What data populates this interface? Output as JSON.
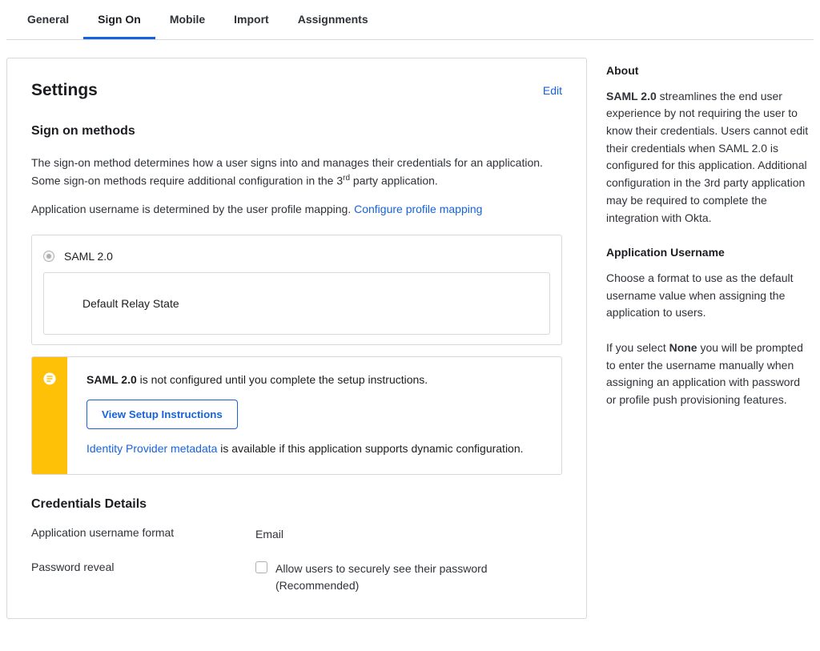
{
  "tabs": {
    "general": "General",
    "sign_on": "Sign On",
    "mobile": "Mobile",
    "import": "Import",
    "assignments": "Assignments"
  },
  "main": {
    "settings_title": "Settings",
    "edit_label": "Edit",
    "sign_on_heading": "Sign on methods",
    "desc1_pre": "The sign-on method determines how a user signs into and manages their credentials for an application. Some sign-on methods require additional configuration in the 3",
    "desc1_sup": "rd",
    "desc1_post": " party application.",
    "desc2_pre": "Application username is determined by the user profile mapping. ",
    "configure_link": "Configure profile mapping",
    "option": {
      "saml_label": "SAML 2.0",
      "relay_label": "Default Relay State"
    },
    "callout": {
      "line1_strong": "SAML 2.0",
      "line1_rest": " is not configured until you complete the setup instructions.",
      "button": "View Setup Instructions",
      "line2_link": "Identity Provider metadata",
      "line2_rest": " is available if this application supports dynamic configuration."
    },
    "cred_heading": "Credentials Details",
    "username_format_label": "Application username format",
    "username_format_value": "Email",
    "pw_reveal_label": "Password reveal",
    "pw_reveal_text": "Allow users to securely see their password (Recommended)"
  },
  "sidebar": {
    "about_heading": "About",
    "about_strong": "SAML 2.0",
    "about_rest": " streamlines the end user experience by not requiring the user to know their credentials. Users cannot edit their credentials when SAML 2.0 is configured for this application. Additional configuration in the 3rd party application may be required to complete the integration with Okta.",
    "app_user_heading": "Application Username",
    "app_user_p1": "Choose a format to use as the default username value when assigning the application to users.",
    "app_user_p2_pre": "If you select ",
    "app_user_p2_strong": "None",
    "app_user_p2_post": " you will be prompted to enter the username manually when assigning an application with password or profile push provisioning features."
  }
}
